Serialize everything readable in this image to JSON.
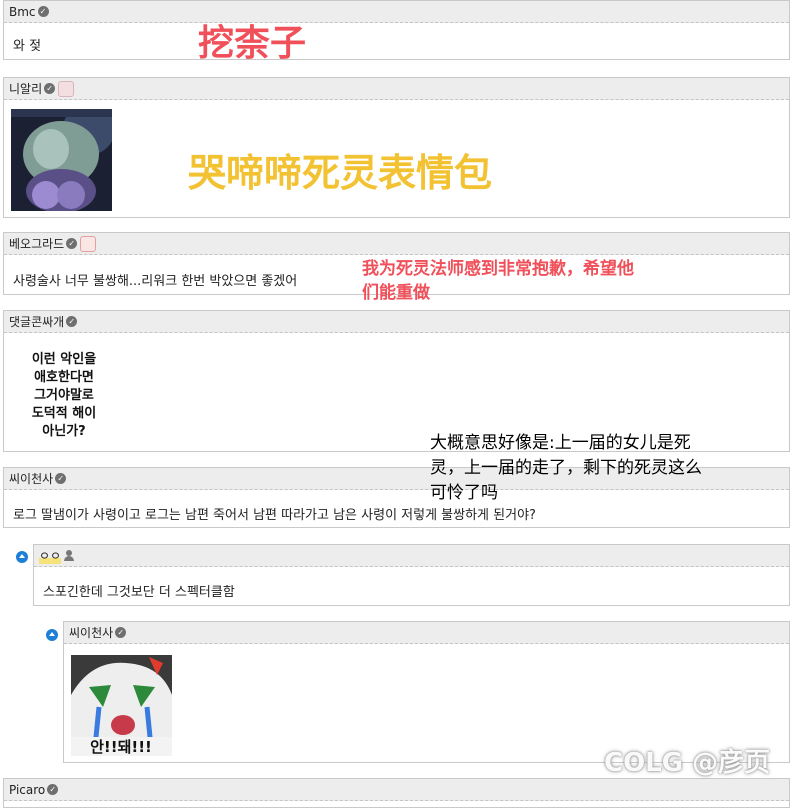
{
  "comments": [
    {
      "user": "Bmc",
      "text": "와 젖"
    },
    {
      "user": "니알리"
    },
    {
      "user": "베오그라드",
      "text": "사령술사 너무 불쌍해...리워크 한번 박았으면 좋겠어"
    },
    {
      "user": "댓글콘싸개",
      "image_lines": [
        "이런 악인을",
        "애호한다면",
        "그거야말로",
        "도덕적 해이",
        "아닌가?"
      ]
    },
    {
      "user": "씨이천사",
      "text": "로그 딸냄이가 사령이고 로그는 남편 죽어서 남편 따라가고 남은 사령이 저렇게 불쌍하게 된거야?"
    },
    {
      "user": "ㅇㅇ",
      "text": "스포긴한데 그것보단 더 스펙터클함"
    },
    {
      "user": "씨이천사",
      "image_caption": "안!!돼!!!"
    },
    {
      "user": "Picaro"
    }
  ],
  "overlays": {
    "o1": "挖柰子",
    "o2": "哭啼啼死灵表情包",
    "o3_line1": "我为死灵法师感到非常抱歉，希望他",
    "o3_line2": "们能重做",
    "o4_line1": "大概意思好像是:上一届的女儿是死",
    "o4_line2": "灵，上一届的走了，剩下的死灵这么",
    "o4_line3": "可怜了吗"
  },
  "watermark": "COLG @彦页",
  "colors": {
    "collapse": "#1e7fd6",
    "red_overlay": "#f0505a",
    "yellow_overlay": "#f2c232",
    "header_bg": "#ededed"
  }
}
